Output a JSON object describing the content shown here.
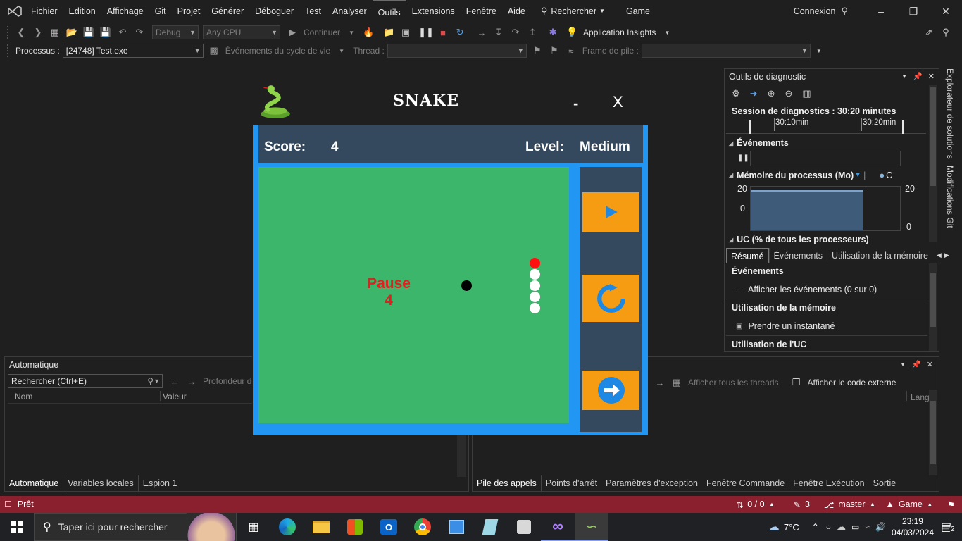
{
  "menubar": {
    "items": [
      "Fichier",
      "Edition",
      "Affichage",
      "Git",
      "Projet",
      "Générer",
      "Déboguer",
      "Test",
      "Analyser",
      "Outils",
      "Extensions",
      "Fenêtre",
      "Aide"
    ],
    "search_label": "Rechercher",
    "solution_name": "Game",
    "signin_label": "Connexion"
  },
  "toolbar1": {
    "config": "Debug",
    "platform": "Any CPU",
    "continue_label": "Continuer",
    "app_insights": "Application Insights"
  },
  "toolbar2": {
    "process_label": "Processus :",
    "process_value": "[24748] Test.exe",
    "lifecycle_label": "Événements du cycle de vie",
    "thread_label": "Thread :",
    "stack_label": "Frame de pile :"
  },
  "diagnostics": {
    "title": "Outils de diagnostic",
    "session": "Session de diagnostics : 30:20 minutes",
    "time_ticks": [
      "30:10min",
      "30:20min"
    ],
    "events_header": "Événements",
    "memory_header": "Mémoire du processus (Mo)",
    "memory_legend_extra": "C",
    "memory_max_left": "20",
    "memory_min_left": "0",
    "memory_max_right": "20",
    "memory_min_right": "0",
    "cpu_header": "UC (% de tous les processeurs)",
    "tabs": [
      "Résumé",
      "Événements",
      "Utilisation de la mémoire"
    ],
    "sections": {
      "events": "Événements",
      "show_events": "Afficher les événements (0 sur 0)",
      "memory_use": "Utilisation de la mémoire",
      "snapshot": "Prendre un instantané",
      "cpu_use": "Utilisation de l'UC"
    },
    "memory_fill": 0.95,
    "accent": "#3e5b7a"
  },
  "side_tabs": [
    "Explorateur de solutions",
    "Modifications Git"
  ],
  "auto_panel": {
    "title": "Automatique",
    "search_placeholder": "Rechercher (Ctrl+E)",
    "depth_label": "Profondeur de",
    "columns": [
      "Nom",
      "Valeur"
    ],
    "bottom_tabs": [
      "Automatique",
      "Variables locales",
      "Espion 1"
    ]
  },
  "callstack_panel": {
    "show_threads": "Afficher tous les threads",
    "show_external": "Afficher le code externe",
    "col_lang": "Lang",
    "bottom_tabs": [
      "Pile des appels",
      "Points d'arrêt",
      "Paramètres d'exception",
      "Fenêtre Commande",
      "Fenêtre Exécution",
      "Sortie"
    ]
  },
  "snake": {
    "title": "SNAKE",
    "min_label": "-",
    "close_label": "X",
    "score_label": "Score:",
    "score_value": "4",
    "level_label": "Level:",
    "level_value": "Medium",
    "pause_text": "Pause",
    "pause_count": "4",
    "colors": {
      "frame": "#2196f3",
      "header": "#34495e",
      "field": "#3cb66a",
      "button": "#f59c12",
      "pause": "#e02020"
    }
  },
  "statusbar": {
    "ready": "Prêt",
    "sync": "0 / 0",
    "edits": "3",
    "branch": "master",
    "repo": "Game"
  },
  "taskbar": {
    "search_placeholder": "Taper ici pour rechercher",
    "weather": "7°C",
    "time": "23:19",
    "date": "04/03/2024",
    "notifications": "2"
  }
}
